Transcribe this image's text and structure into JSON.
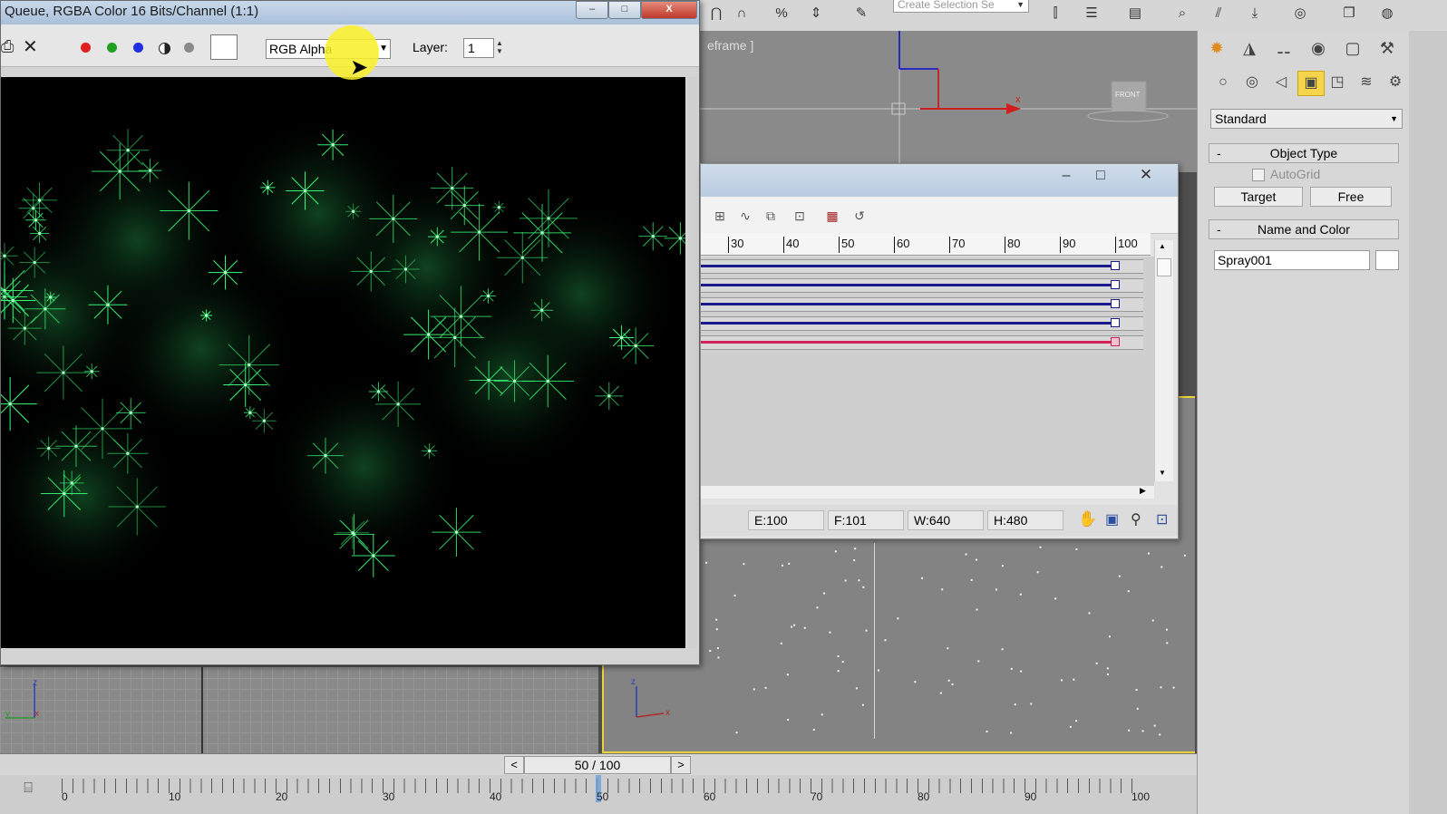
{
  "render_window": {
    "title": "Queue, RGBA Color 16 Bits/Channel (1:1)",
    "channel_select": "RGB Alpha",
    "layer_label": "Layer:",
    "layer_value": "1",
    "minimize": "–",
    "maximize": "□",
    "close": "X"
  },
  "top_toolbar": {
    "selection_set_placeholder": "Create Selection Se"
  },
  "viewports": {
    "top_label": "eframe ]",
    "front_cube": "FRONT",
    "axis_x": "x",
    "axis_z": "z",
    "axis_y": "y"
  },
  "track_view": {
    "ruler": [
      "30",
      "40",
      "50",
      "60",
      "70",
      "80",
      "90",
      "100"
    ],
    "tracks": [
      {
        "color": "#1a1a8c"
      },
      {
        "color": "#1a1a8c"
      },
      {
        "color": "#1a1a8c"
      },
      {
        "color": "#1a1a8c"
      },
      {
        "color": "#d4205a"
      }
    ],
    "status": {
      "end": "E:100",
      "frames": "F:101",
      "width": "W:640",
      "height": "H:480"
    },
    "minimize": "–",
    "maximize": "□",
    "close": "✕"
  },
  "command_panel": {
    "dropdown": "Standard",
    "object_type_title": "Object Type",
    "autogrid_label": "AutoGrid",
    "target_button": "Target",
    "free_button": "Free",
    "name_color_title": "Name and Color",
    "name_value": "Spray001",
    "rollout_minus": "-"
  },
  "time_slider": {
    "prev": "<",
    "next": ">",
    "frame": "50 / 100"
  },
  "track_bar": {
    "labels": [
      "0",
      "10",
      "20",
      "30",
      "40",
      "50",
      "60",
      "70",
      "80",
      "90",
      "100"
    ]
  },
  "colors": {
    "viewport_active_border": "#e8d23a",
    "sparkle": "#3cff7a",
    "track_blue": "#1a1a8c",
    "track_red": "#d4205a"
  }
}
